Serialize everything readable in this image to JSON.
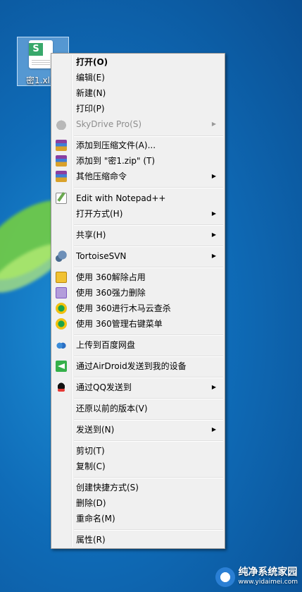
{
  "desktop": {
    "file_label": "密1.xl",
    "icon_badge": "S"
  },
  "menu": {
    "items": [
      {
        "label": "打开(O)",
        "bold": true
      },
      {
        "label": "编辑(E)"
      },
      {
        "label": "新建(N)"
      },
      {
        "label": "打印(P)"
      },
      {
        "label": "SkyDrive Pro(S)",
        "disabled": true,
        "submenu": true,
        "icon": "cloud-icon"
      },
      {
        "label": "添加到压缩文件(A)...",
        "icon": "winrar-icon"
      },
      {
        "label": "添加到 \"密1.zip\" (T)",
        "icon": "winrar-icon"
      },
      {
        "label": "其他压缩命令",
        "submenu": true,
        "icon": "winrar-icon"
      },
      {
        "label": "Edit with Notepad++",
        "icon": "notepad-plus-plus-icon"
      },
      {
        "label": "打开方式(H)",
        "submenu": true
      },
      {
        "label": "共享(H)",
        "submenu": true
      },
      {
        "label": "TortoiseSVN",
        "submenu": true,
        "icon": "tortoisesvn-icon"
      },
      {
        "label": "使用 360解除占用",
        "icon": "360-unlock-icon"
      },
      {
        "label": "使用 360强力删除",
        "icon": "360-shred-icon"
      },
      {
        "label": "使用 360进行木马云查杀",
        "icon": "360-scan-icon"
      },
      {
        "label": "使用 360管理右键菜单",
        "icon": "360-scan-icon"
      },
      {
        "label": "上传到百度网盘",
        "icon": "baidu-netdisk-icon"
      },
      {
        "label": "通过AirDroid发送到我的设备",
        "icon": "airdroid-icon"
      },
      {
        "label": "通过QQ发送到",
        "submenu": true,
        "icon": "qq-icon"
      },
      {
        "label": "还原以前的版本(V)"
      },
      {
        "label": "发送到(N)",
        "submenu": true
      },
      {
        "label": "剪切(T)"
      },
      {
        "label": "复制(C)"
      },
      {
        "label": "创建快捷方式(S)"
      },
      {
        "label": "删除(D)"
      },
      {
        "label": "重命名(M)"
      },
      {
        "label": "属性(R)"
      }
    ],
    "submenu_arrow": "▶"
  },
  "watermark": {
    "title": "纯净系统家园",
    "subtitle": "www.yidaimei.com"
  }
}
